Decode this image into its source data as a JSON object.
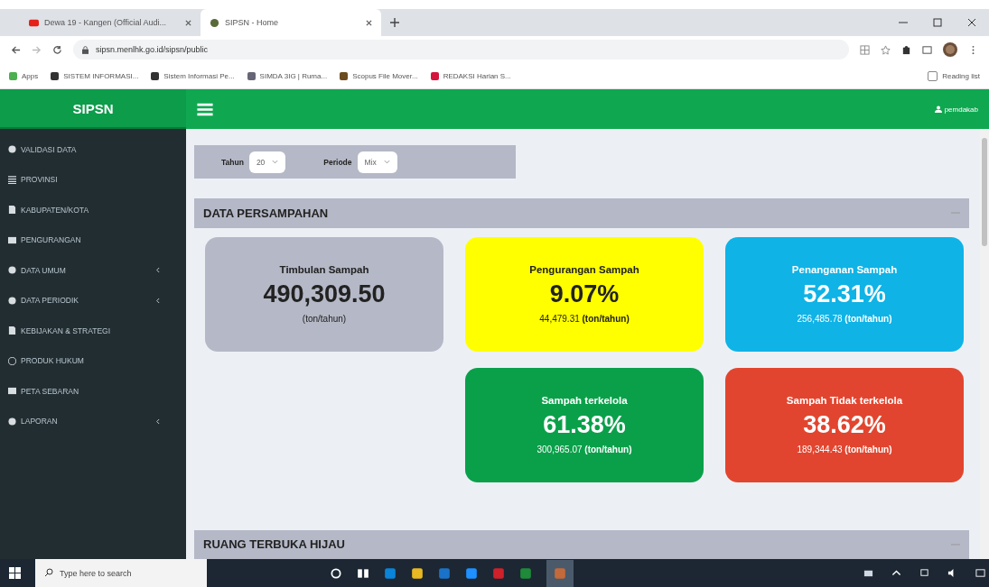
{
  "browser": {
    "tabs": [
      {
        "title": "Dewa 19 - Kangen (Official Audi...",
        "selected": false
      },
      {
        "title": "SIPSN - Home",
        "selected": true
      }
    ],
    "url": "sipsn.menlhk.go.id/sipsn/public",
    "bookmarks": [
      "Apps",
      "SISTEM INFORMASI...",
      "Sistem Informasi Pe...",
      "SIMDA 3IG | Ruma...",
      "Scopus File Mover...",
      "REDAKSI Harian S..."
    ],
    "reading_list": "Reading list"
  },
  "app": {
    "brand": "SIPSN",
    "user": "pemdakab"
  },
  "sidebar": {
    "items": [
      {
        "label": "VALIDASI DATA",
        "expandable": false
      },
      {
        "label": "PROVINSI",
        "expandable": false
      },
      {
        "label": "KABUPATEN/KOTA",
        "expandable": false
      },
      {
        "label": "PENGURANGAN",
        "expandable": false
      },
      {
        "label": "DATA UMUM",
        "expandable": true
      },
      {
        "label": "DATA PERIODIK",
        "expandable": true
      },
      {
        "label": "KEBIJAKAN & STRATEGI",
        "expandable": false
      },
      {
        "label": "PRODUK HUKUM",
        "expandable": false
      },
      {
        "label": "PETA SEBARAN",
        "expandable": false
      },
      {
        "label": "LAPORAN",
        "expandable": true
      }
    ]
  },
  "filters": [
    {
      "label": "Tahun",
      "value": "20"
    },
    {
      "label": "Periode",
      "value": "Mix"
    }
  ],
  "sections": [
    {
      "title": "DATA PERSAMPAHAN",
      "cards": [
        {
          "title": "Timbulan Sampah",
          "value": "490,309.50",
          "detail": "(ton/tahun)",
          "color": "#b5b8c6"
        },
        {
          "title": "Pengurangan Sampah",
          "value": "9.07%",
          "detail": "44,479.31 **(ton/tahun)**",
          "color": "#ffff00"
        },
        {
          "title": "Penanganan Sampah",
          "value": "52.31%",
          "detail": "256,485.78 **(ton/tahun)**",
          "color": "#0fb3e6"
        },
        {
          "title": "Sampah terkelola",
          "value": "61.38%",
          "detail": "300,965.07 **(ton/tahun)**",
          "color": "#0aa04a"
        },
        {
          "title": "Sampah Tidak terkelola",
          "value": "38.62%",
          "detail": "189,344.43 **(ton/tahun)**",
          "color": "#e2452f"
        }
      ]
    },
    {
      "title": "RUANG TERBUKA HIJAU"
    }
  ],
  "taskbar": {
    "search_placeholder": "Type here to search"
  }
}
